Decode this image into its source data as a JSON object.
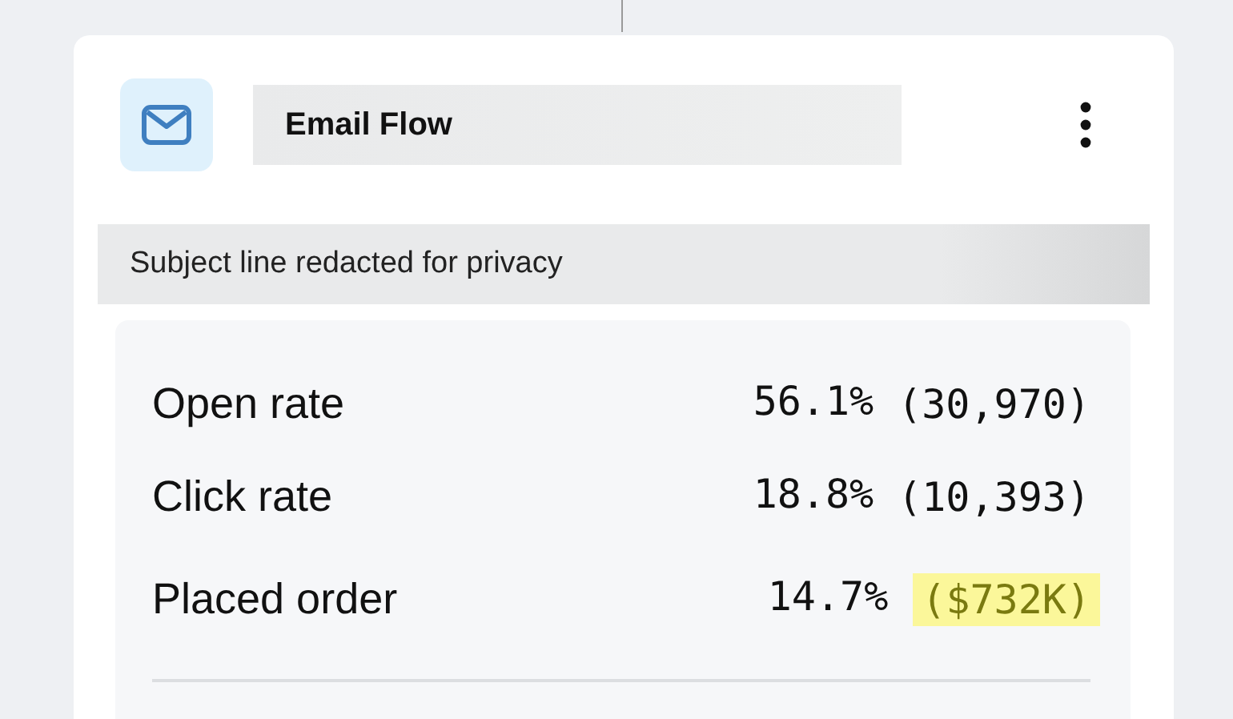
{
  "card": {
    "title": "Email Flow",
    "subject": "Subject line redacted for privacy"
  },
  "metrics": [
    {
      "label": "Open rate",
      "percent": "56.1%",
      "count": "(30,970)",
      "highlighted": false
    },
    {
      "label": "Click rate",
      "percent": "18.8%",
      "count": "(10,393)",
      "highlighted": false
    },
    {
      "label": "Placed order",
      "percent": "14.7%",
      "count": "($732K)",
      "highlighted": true
    }
  ]
}
